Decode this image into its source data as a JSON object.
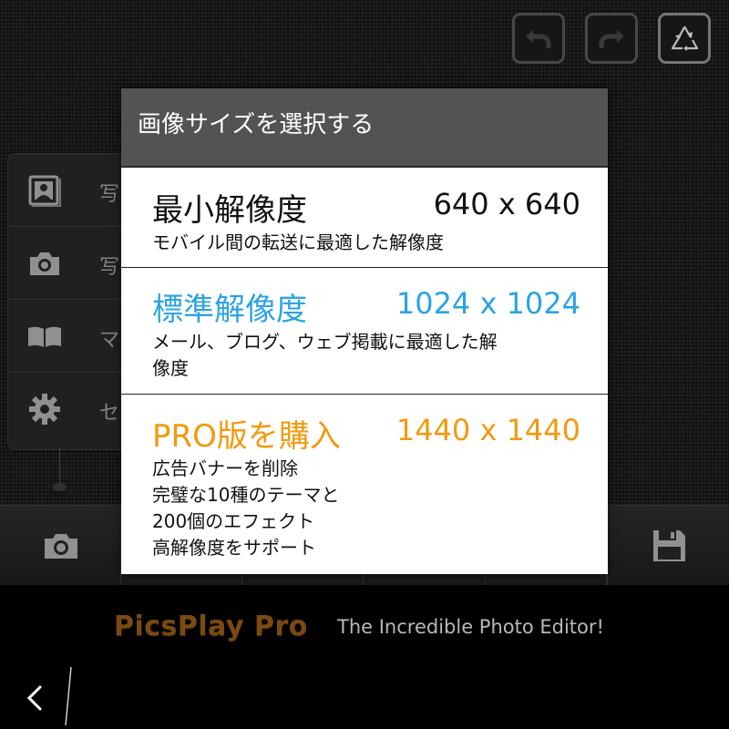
{
  "top_buttons": {
    "undo_icon": "undo-arrow-icon",
    "redo_icon": "redo-arrow-icon",
    "recycle_icon": "recycle-icon"
  },
  "side_menu": {
    "items": [
      {
        "icon": "photo-album-icon",
        "label": "写"
      },
      {
        "icon": "camera-icon",
        "label": "写"
      },
      {
        "icon": "book-icon",
        "label": "マ"
      },
      {
        "icon": "gear-icon",
        "label": "セ"
      }
    ]
  },
  "toolbar": {
    "camera_icon": "camera-icon",
    "save_icon": "floppy-disk-icon"
  },
  "dialog": {
    "title": "画像サイズを選択する",
    "options": [
      {
        "name": "最小解像度",
        "resolution": "640 x 640",
        "description_lines": [
          "モバイル間の転送に最適した解像度"
        ],
        "color": "#111111"
      },
      {
        "name": "標準解像度",
        "resolution": "1024 x 1024",
        "description_lines": [
          "メール、ブログ、ウェブ掲載に最適した解",
          "像度"
        ],
        "color": "#2ba3e3"
      },
      {
        "name": "PRO版を購入",
        "resolution": "1440 x 1440",
        "description_lines": [
          "広告バナーを削除",
          "完璧な10種のテーマと",
          "200個のエフェクト",
          "高解像度をサポート"
        ],
        "color": "#f19a0f"
      }
    ]
  },
  "brand": {
    "name": "PicsPlay Pro",
    "tagline": "The Incredible Photo Editor!",
    "name_color": "#7a4a10"
  },
  "navbar": {
    "back_icon": "chevron-left-icon"
  }
}
